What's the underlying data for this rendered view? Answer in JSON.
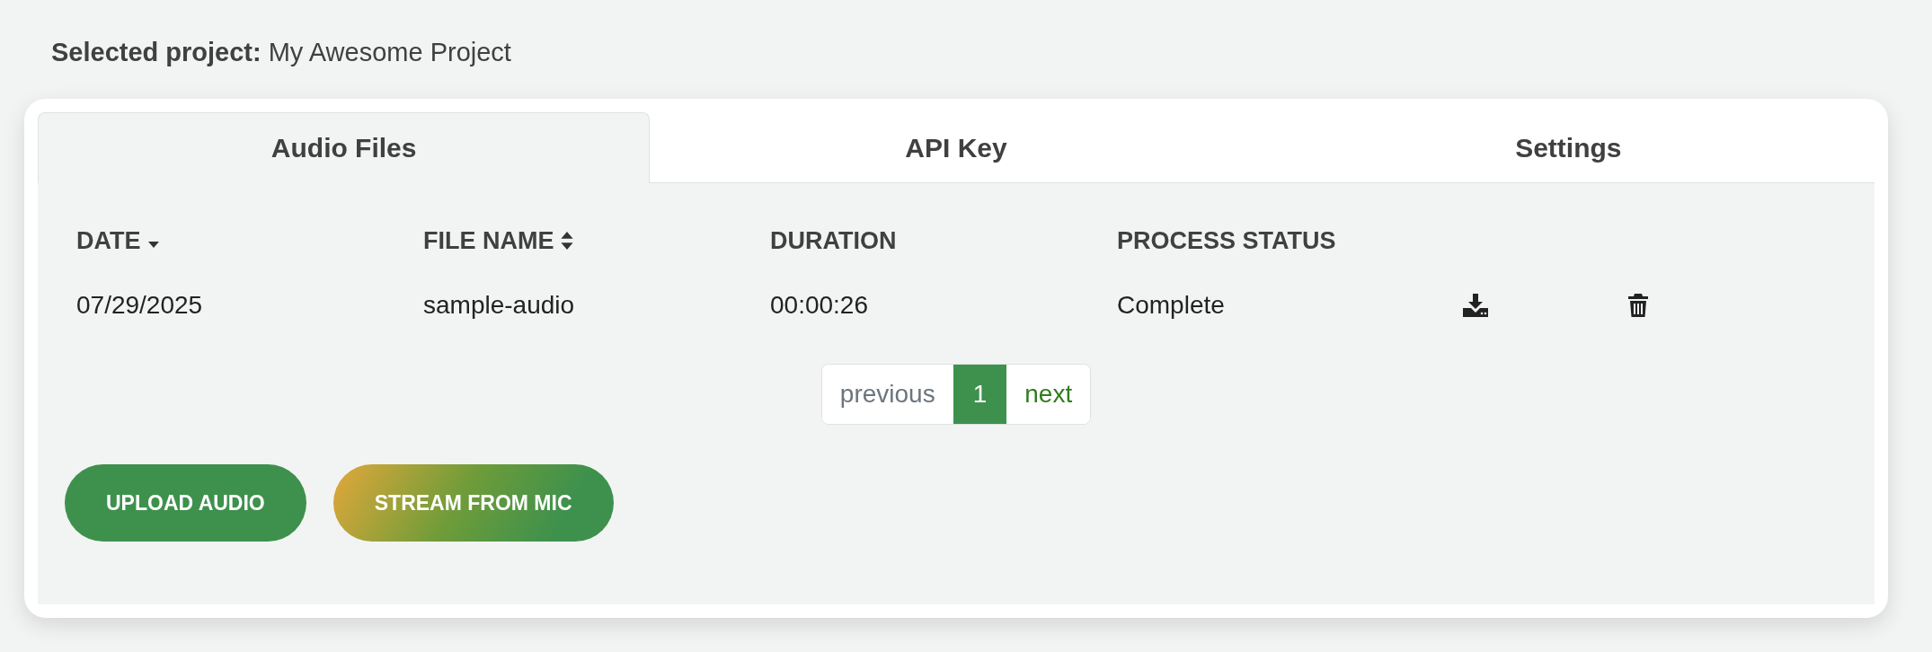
{
  "selected_project": {
    "label": "Selected project:",
    "value": "My Awesome Project"
  },
  "tabs": [
    {
      "label": "Audio Files",
      "selected": true
    },
    {
      "label": "API Key",
      "selected": false
    },
    {
      "label": "Settings",
      "selected": false
    }
  ],
  "table": {
    "columns": [
      {
        "label": "DATE",
        "sortable": true,
        "sorted_desc": true
      },
      {
        "label": "FILE NAME",
        "sortable": true,
        "sorted_desc": false
      },
      {
        "label": "DURATION",
        "sortable": false
      },
      {
        "label": "PROCESS STATUS",
        "sortable": false
      }
    ],
    "rows": [
      {
        "cells": [
          "07/29/2025",
          "sample-audio",
          "00:00:26",
          "Complete"
        ]
      }
    ]
  },
  "pagination": {
    "previous": {
      "label": "previous",
      "disabled": true
    },
    "pages": [
      {
        "label": "1",
        "selected": true
      }
    ],
    "next": {
      "label": "next",
      "disabled": false
    }
  },
  "buttons": [
    {
      "label": "UPLOAD AUDIO",
      "kind": "solid"
    },
    {
      "label": "STREAM FROM MIC",
      "kind": "gradient"
    }
  ]
}
